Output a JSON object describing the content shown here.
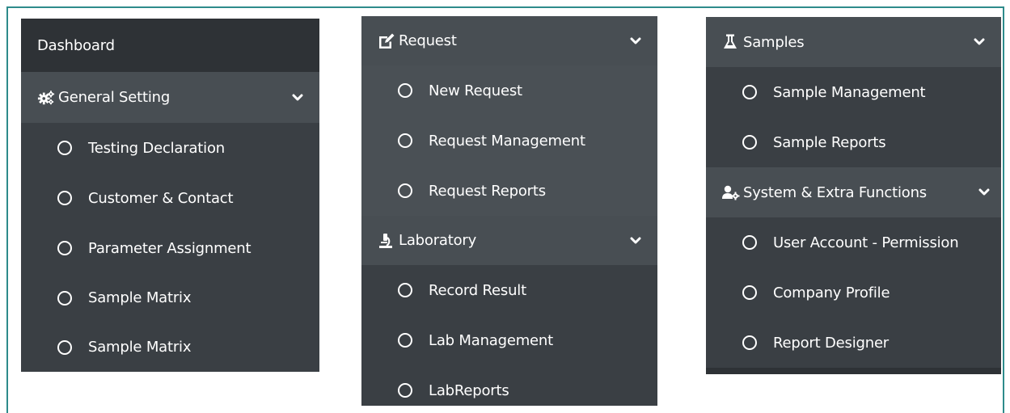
{
  "panel1": {
    "dashboard": "Dashboard",
    "header": {
      "label": "General Setting",
      "icon": "gears-icon"
    },
    "items": [
      "Testing Declaration",
      "Customer & Contact",
      "Parameter Assignment",
      "Sample Matrix",
      "Sample Matrix"
    ]
  },
  "panel2": {
    "request": {
      "label": "Request",
      "icon": "edit-icon",
      "items": [
        "New Request",
        "Request Management",
        "Request Reports"
      ]
    },
    "laboratory": {
      "label": "Laboratory",
      "icon": "microscope-icon",
      "items": [
        "Record Result",
        "Lab Management",
        "LabReports"
      ]
    }
  },
  "panel3": {
    "samples": {
      "label": "Samples",
      "icon": "flask-icon",
      "items": [
        "Sample Management",
        "Sample Reports"
      ]
    },
    "system": {
      "label": "System & Extra Functions",
      "icon": "user-gear-icon",
      "items": [
        "User Account - Permission",
        "Company Profile",
        "Report Designer"
      ]
    }
  },
  "colors": {
    "frame": "#2e8b8b",
    "panel": "#3a3f44",
    "header": "#484e53",
    "dashboard": "#2e3236",
    "text": "#ffffff"
  }
}
